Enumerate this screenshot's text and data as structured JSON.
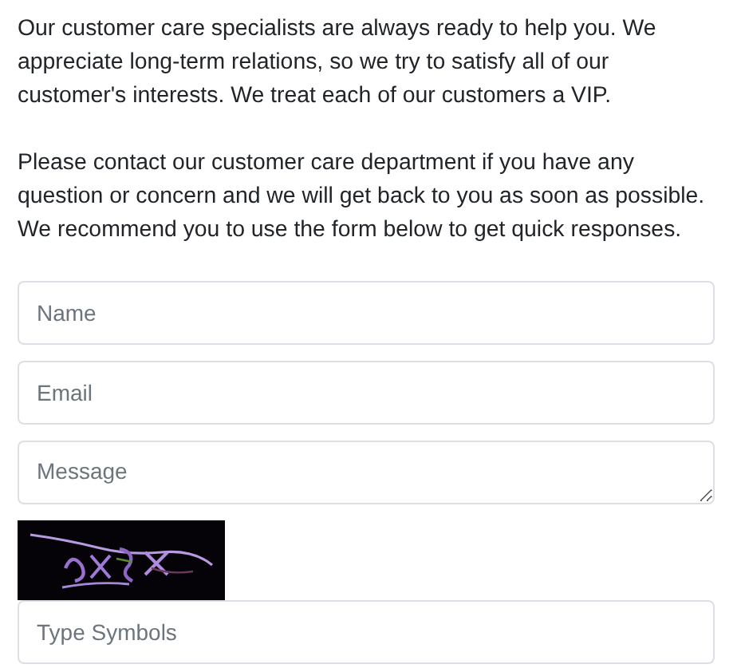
{
  "paragraphs": [
    "Our customer care specialists are always ready to help you. We appreciate long-term relations, so we try to satisfy all of our customer's interests. We treat each of our customers a VIP.",
    "Please contact our customer care department if you have any question or concern and we will get back to you as soon as possible. We recommend you to use the form below to get quick responses."
  ],
  "form": {
    "fields": [
      {
        "kind": "input",
        "placeholder": "Name"
      },
      {
        "kind": "input",
        "placeholder": "Email"
      },
      {
        "kind": "textarea",
        "placeholder": "Message"
      },
      {
        "kind": "captcha"
      },
      {
        "kind": "input",
        "placeholder": "Type Symbols"
      }
    ]
  }
}
